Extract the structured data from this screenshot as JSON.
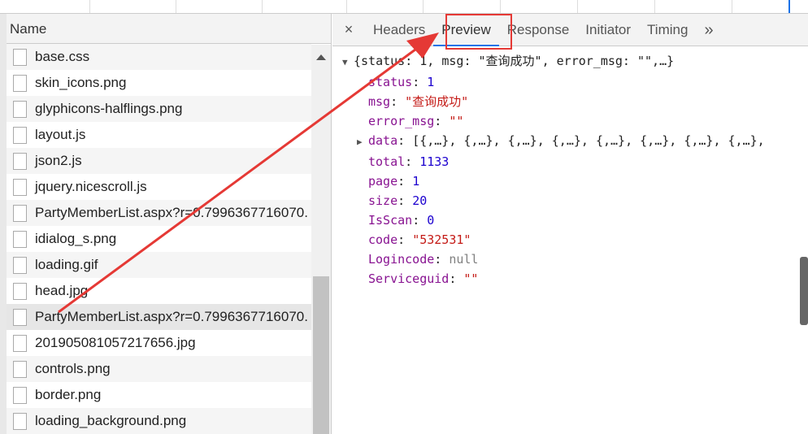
{
  "network": {
    "name_header": "Name",
    "files": [
      {
        "name": "base.css",
        "icon": "css-file-icon"
      },
      {
        "name": "skin_icons.png",
        "icon": "image-file-icon"
      },
      {
        "name": "glyphicons-halflings.png",
        "icon": "image-file-icon"
      },
      {
        "name": "layout.js",
        "icon": "script-file-icon"
      },
      {
        "name": "json2.js",
        "icon": "script-file-icon"
      },
      {
        "name": "jquery.nicescroll.js",
        "icon": "script-file-icon"
      },
      {
        "name": "PartyMemberList.aspx?r=0.7996367716070.",
        "icon": "document-file-icon"
      },
      {
        "name": "idialog_s.png",
        "icon": "image-file-icon"
      },
      {
        "name": "loading.gif",
        "icon": "image-file-icon"
      },
      {
        "name": "head.jpg",
        "icon": "image-file-icon"
      },
      {
        "name": "PartyMemberList.aspx?r=0.7996367716070.",
        "icon": "document-file-icon",
        "selected": true
      },
      {
        "name": "201905081057217656.jpg",
        "icon": "image-file-icon"
      },
      {
        "name": "controls.png",
        "icon": "image-file-icon"
      },
      {
        "name": "border.png",
        "icon": "image-file-icon"
      },
      {
        "name": "loading_background.png",
        "icon": "image-file-icon"
      }
    ]
  },
  "tabs": {
    "close": "×",
    "items": [
      "Headers",
      "Preview",
      "Response",
      "Initiator",
      "Timing"
    ],
    "active": "Preview",
    "more": "»"
  },
  "preview": {
    "summary": "{status: 1, msg: \"查询成功\", error_msg: \"\",…}",
    "fields": [
      {
        "key": "status",
        "value": "1",
        "type": "n"
      },
      {
        "key": "msg",
        "value": "\"查询成功\"",
        "type": "s"
      },
      {
        "key": "error_msg",
        "value": "\"\"",
        "type": "s"
      },
      {
        "key": "data",
        "value": "[{,…}, {,…}, {,…}, {,…}, {,…}, {,…}, {,…}, {,…},",
        "type": "arr"
      },
      {
        "key": "total",
        "value": "1133",
        "type": "n"
      },
      {
        "key": "page",
        "value": "1",
        "type": "n"
      },
      {
        "key": "size",
        "value": "20",
        "type": "n"
      },
      {
        "key": "IsScan",
        "value": "0",
        "type": "n"
      },
      {
        "key": "code",
        "value": "\"532531\"",
        "type": "s"
      },
      {
        "key": "Logincode",
        "value": "null",
        "type": "nl"
      },
      {
        "key": "Serviceguid",
        "value": "\"\"",
        "type": "s"
      }
    ]
  },
  "colors": {
    "annotation": "#e53935",
    "active_tab": "#1a73e8"
  }
}
